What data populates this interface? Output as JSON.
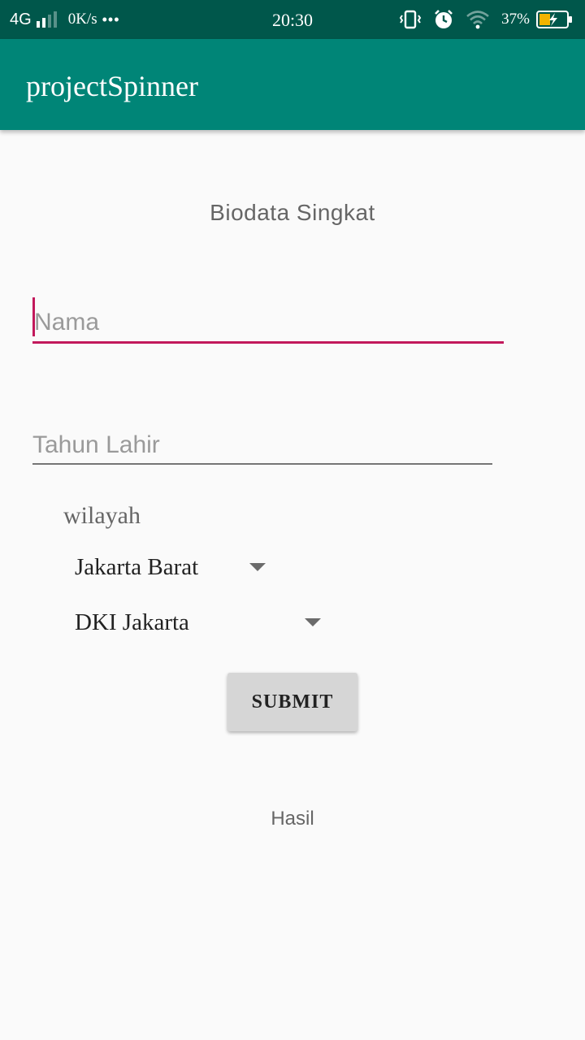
{
  "status_bar": {
    "network": "4G",
    "speed": "0K/s",
    "dots": "•••",
    "time": "20:30",
    "battery_percent": "37%",
    "icons": [
      "signal-icon",
      "vibrate-icon",
      "alarm-icon",
      "wifi-icon",
      "battery-charging-icon"
    ]
  },
  "app_bar": {
    "title": "projectSpinner",
    "color": "#008577"
  },
  "form": {
    "heading": "Biodata Singkat",
    "name_placeholder": "Nama",
    "name_value": "",
    "year_placeholder": "Tahun Lahir",
    "year_value": "",
    "region_label": "wilayah",
    "city_selected": "Jakarta Barat",
    "province_selected": "DKI Jakarta",
    "submit_label": "SUBMIT",
    "result_text": "Hasil"
  },
  "colors": {
    "status_bar": "#00574b",
    "accent": "#c2185b",
    "background": "#fafafa",
    "button": "#d6d6d6"
  }
}
